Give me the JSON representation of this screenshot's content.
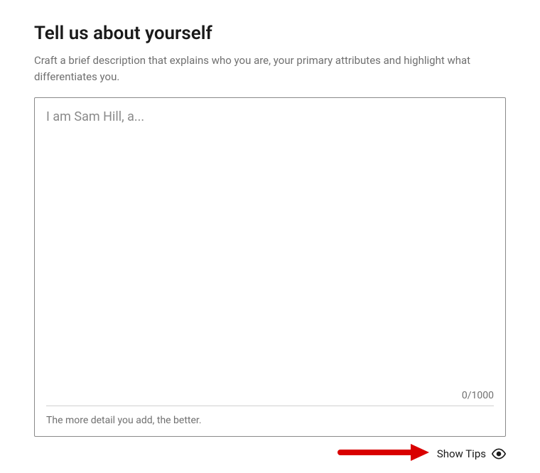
{
  "header": {
    "title": "Tell us about yourself",
    "subtitle": "Craft a brief description that explains who you are, your primary attributes and highlight what differentiates you."
  },
  "form": {
    "about_placeholder": "I am Sam Hill, a...",
    "about_value": "",
    "char_counter": "0/1000",
    "helper_text": "The more detail you add, the better."
  },
  "footer": {
    "show_tips_label": "Show Tips"
  }
}
